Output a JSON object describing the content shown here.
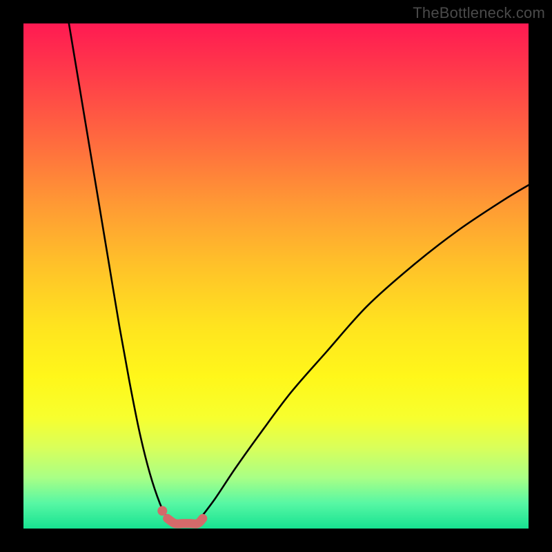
{
  "watermark": "TheBottleneck.com",
  "colors": {
    "frame": "#000000",
    "curve": "#000000",
    "highlight": "#d46a6a"
  },
  "chart_data": {
    "type": "line",
    "title": "",
    "xlabel": "",
    "ylabel": "",
    "xlim": [
      0,
      100
    ],
    "ylim": [
      0,
      100
    ],
    "grid": false,
    "legend": false,
    "series": [
      {
        "name": "left-branch",
        "x": [
          9,
          11,
          13,
          15,
          17,
          19,
          21,
          23,
          25,
          27,
          28.5
        ],
        "y": [
          100,
          88,
          76,
          64,
          52,
          40,
          29,
          19,
          11,
          5,
          2
        ]
      },
      {
        "name": "right-branch",
        "x": [
          35,
          38,
          42,
          47,
          53,
          60,
          68,
          77,
          86,
          95,
          100
        ],
        "y": [
          2,
          6,
          12,
          19,
          27,
          35,
          44,
          52,
          59,
          65,
          68
        ]
      },
      {
        "name": "valley-floor",
        "x": [
          28.5,
          30,
          31.5,
          33,
          34.5,
          35.5
        ],
        "y": [
          2,
          1,
          1,
          1,
          1,
          2
        ]
      }
    ],
    "annotations": [
      {
        "name": "highlight-dot",
        "x": 27.5,
        "y": 3.5
      }
    ]
  }
}
